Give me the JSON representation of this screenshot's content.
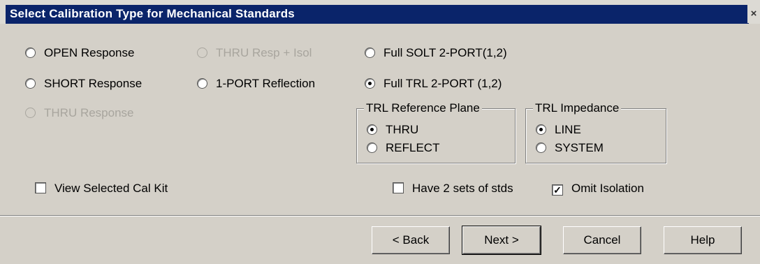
{
  "dialog": {
    "title": "Select Calibration Type for Mechanical Standards",
    "close_glyph": "×"
  },
  "options": {
    "open_response": "OPEN Response",
    "short_response": "SHORT Response",
    "thru_response": "THRU Response",
    "thru_resp_isol": "THRU Resp + Isol",
    "one_port_reflection": "1-PORT Reflection",
    "full_solt": "Full SOLT 2-PORT(1,2)",
    "full_trl": "Full TRL 2-PORT (1,2)"
  },
  "trl_reference_plane": {
    "legend": "TRL Reference Plane",
    "thru": "THRU",
    "reflect": "REFLECT"
  },
  "trl_impedance": {
    "legend": "TRL Impedance",
    "line": "LINE",
    "system": "SYSTEM"
  },
  "checkboxes": {
    "view_cal_kit": "View Selected Cal Kit",
    "have_2_sets": "Have 2 sets of stds",
    "omit_isolation": "Omit Isolation",
    "check_glyph": "✓"
  },
  "buttons": {
    "back": "< Back",
    "next": "Next >",
    "cancel": "Cancel",
    "help": "Help"
  }
}
